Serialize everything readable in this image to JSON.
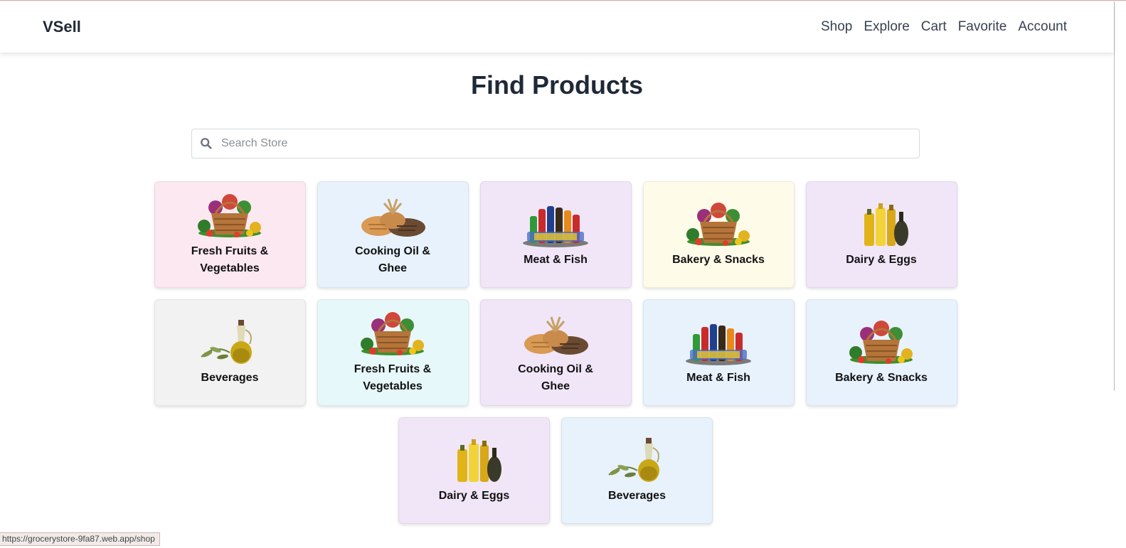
{
  "nav": {
    "brand": "VSell",
    "links": [
      "Shop",
      "Explore",
      "Cart",
      "Favorite",
      "Account"
    ]
  },
  "main": {
    "title": "Find Products",
    "search_placeholder": "Search Store"
  },
  "categories": [
    {
      "label": "Fresh Fruits & Vegetables",
      "icon": "fruit-basket-icon",
      "bg": "#fce8f1"
    },
    {
      "label": "Cooking Oil & Ghee",
      "icon": "bread-icon",
      "bg": "#e8f2fc"
    },
    {
      "label": "Meat & Fish",
      "icon": "bottles-icon",
      "bg": "#f1e6f7"
    },
    {
      "label": "Bakery & Snacks",
      "icon": "fruit-basket-icon",
      "bg": "#fefbe9"
    },
    {
      "label": "Dairy & Eggs",
      "icon": "oil-bottles-icon",
      "bg": "#f1e6f7"
    },
    {
      "label": "Beverages",
      "icon": "olive-oil-icon",
      "bg": "#f2f2f2"
    },
    {
      "label": "Fresh Fruits & Vegetables",
      "icon": "fruit-basket-icon",
      "bg": "#e7f8fb"
    },
    {
      "label": "Cooking Oil & Ghee",
      "icon": "bread-icon",
      "bg": "#f1e6f7"
    },
    {
      "label": "Meat & Fish",
      "icon": "bottles-icon",
      "bg": "#e8f2fc"
    },
    {
      "label": "Bakery & Snacks",
      "icon": "fruit-basket-icon",
      "bg": "#e8f2fc"
    },
    {
      "label": "Dairy & Eggs",
      "icon": "oil-bottles-icon",
      "bg": "#f1e6f7"
    },
    {
      "label": "Beverages",
      "icon": "olive-oil-icon",
      "bg": "#e8f2fc"
    }
  ],
  "status_bar": {
    "url": "https://grocerystore-9fa87.web.app/shop"
  }
}
